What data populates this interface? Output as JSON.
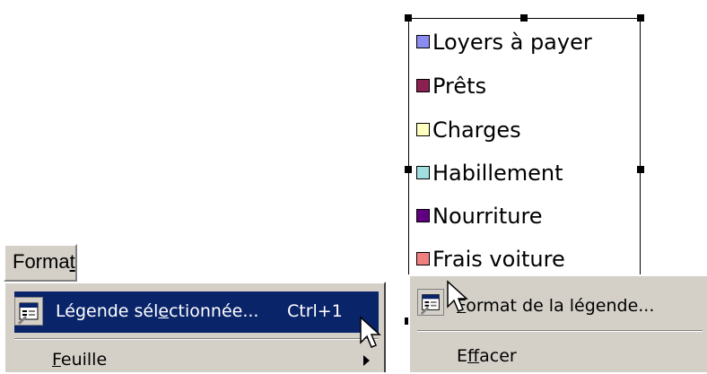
{
  "format_menu": {
    "menubar_label_pre": "Forma",
    "menubar_label_ul": "t",
    "items": [
      {
        "label_pre": "Légende sél",
        "label_ul": "e",
        "label_post": "ctionnée...",
        "shortcut": "Ctrl+1",
        "icon": "properties-icon",
        "selected": true
      },
      {
        "label_pre": "",
        "label_ul": "F",
        "label_post": "euille",
        "icon": "",
        "has_submenu": true
      }
    ]
  },
  "legend": {
    "items": [
      {
        "label": "Loyers à payer",
        "color": "#8c8cf0"
      },
      {
        "label": "Prêts",
        "color": "#8c2050"
      },
      {
        "label": "Charges",
        "color": "#ffffc0"
      },
      {
        "label": "Habillement",
        "color": "#a0e0e0"
      },
      {
        "label": "Nourriture",
        "color": "#600080"
      },
      {
        "label": "Frais voiture",
        "color": "#f08080"
      }
    ]
  },
  "context_menu": {
    "items": [
      {
        "label_pre": "",
        "label_ul": "F",
        "label_post": "ormat de la légende...",
        "icon": "properties-icon"
      },
      {
        "label_pre": "E",
        "label_ul": "f",
        "label_post": "facer"
      }
    ]
  },
  "colors": {
    "menu_bg": "#d4d0c8",
    "selection": "#0a246a"
  }
}
